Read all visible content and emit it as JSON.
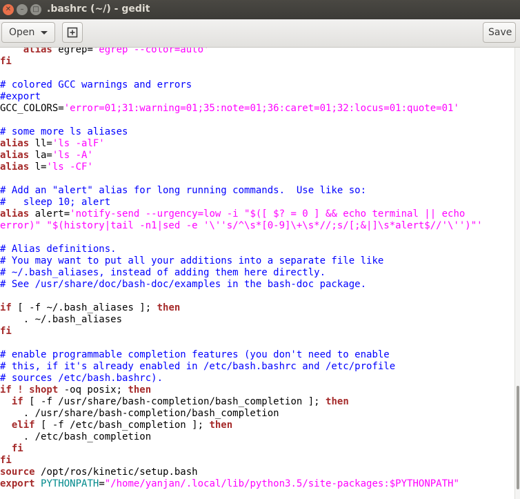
{
  "window": {
    "title": ".bashrc (~/) - gedit",
    "close_glyph": "✕",
    "minimize_glyph": "–",
    "maximize_glyph": "□"
  },
  "toolbar": {
    "open_label": "Open",
    "new_tab_icon": "new-document-icon",
    "save_label": "Save"
  },
  "editor": {
    "lines": [
      [
        [
          "keyword",
          "    alias "
        ],
        [
          "plain",
          "egrep="
        ],
        [
          "string",
          "'egrep --color=auto'"
        ]
      ],
      [
        [
          "keyword",
          "fi"
        ]
      ],
      [],
      [
        [
          "comment",
          "# colored GCC warnings and errors"
        ]
      ],
      [
        [
          "comment",
          "#export"
        ]
      ],
      [
        [
          "plain",
          "GCC_COLORS="
        ],
        [
          "string",
          "'error=01;31:warning=01;35:note=01;36:caret=01;32:locus=01:quote=01'"
        ]
      ],
      [],
      [
        [
          "comment",
          "# some more ls aliases"
        ]
      ],
      [
        [
          "keyword",
          "alias "
        ],
        [
          "plain",
          "ll="
        ],
        [
          "string",
          "'ls -alF'"
        ]
      ],
      [
        [
          "keyword",
          "alias "
        ],
        [
          "plain",
          "la="
        ],
        [
          "string",
          "'ls -A'"
        ]
      ],
      [
        [
          "keyword",
          "alias "
        ],
        [
          "plain",
          "l="
        ],
        [
          "string",
          "'ls -CF'"
        ]
      ],
      [],
      [
        [
          "comment",
          "# Add an \"alert\" alias for long running commands.  Use like so:"
        ]
      ],
      [
        [
          "comment",
          "#   sleep 10; alert"
        ]
      ],
      [
        [
          "keyword",
          "alias "
        ],
        [
          "plain",
          "alert="
        ],
        [
          "string",
          "'notify-send --urgency=low -i \"$([ $? = 0 ] && echo terminal || echo"
        ]
      ],
      [
        [
          "string",
          "error)\" \"$(history|tail -n1|sed -e '\\''s/^\\s*[0-9]\\+\\s*//;s/[;&|]\\s*alert$//'\\'')\"'"
        ]
      ],
      [],
      [
        [
          "comment",
          "# Alias definitions."
        ]
      ],
      [
        [
          "comment",
          "# You may want to put all your additions into a separate file like"
        ]
      ],
      [
        [
          "comment",
          "# ~/.bash_aliases, instead of adding them here directly."
        ]
      ],
      [
        [
          "comment",
          "# See /usr/share/doc/bash-doc/examples in the bash-doc package."
        ]
      ],
      [],
      [
        [
          "keyword",
          "if "
        ],
        [
          "plain",
          "[ -f ~/.bash_aliases ]; "
        ],
        [
          "keyword",
          "then"
        ]
      ],
      [
        [
          "plain",
          "    . ~/.bash_aliases"
        ]
      ],
      [
        [
          "keyword",
          "fi"
        ]
      ],
      [],
      [
        [
          "comment",
          "# enable programmable completion features (you don't need to enable"
        ]
      ],
      [
        [
          "comment",
          "# this, if it's already enabled in /etc/bash.bashrc and /etc/profile"
        ]
      ],
      [
        [
          "comment",
          "# sources /etc/bash.bashrc)."
        ]
      ],
      [
        [
          "keyword",
          "if ! shopt "
        ],
        [
          "plain",
          "-oq posix; "
        ],
        [
          "keyword",
          "then"
        ]
      ],
      [
        [
          "keyword",
          "  if "
        ],
        [
          "plain",
          "[ -f /usr/share/bash-completion/bash_completion ]; "
        ],
        [
          "keyword",
          "then"
        ]
      ],
      [
        [
          "plain",
          "    . /usr/share/bash-completion/bash_completion"
        ]
      ],
      [
        [
          "keyword",
          "  elif "
        ],
        [
          "plain",
          "[ -f /etc/bash_completion ]; "
        ],
        [
          "keyword",
          "then"
        ]
      ],
      [
        [
          "plain",
          "    . /etc/bash_completion"
        ]
      ],
      [
        [
          "keyword",
          "  fi"
        ]
      ],
      [
        [
          "keyword",
          "fi"
        ]
      ],
      [
        [
          "keyword",
          "source "
        ],
        [
          "plain",
          "/opt/ros/kinetic/setup.bash"
        ]
      ],
      [
        [
          "keyword",
          "export "
        ],
        [
          "variable",
          "PYTHONPATH"
        ],
        [
          "plain",
          "="
        ],
        [
          "string",
          "\"/home/yanjan/.local/lib/python3.5/site-packages:$PYTHONPATH\""
        ]
      ]
    ]
  }
}
